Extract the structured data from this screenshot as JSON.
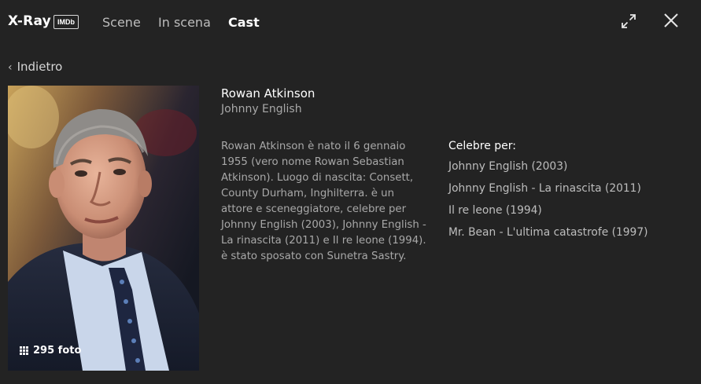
{
  "header": {
    "brand": "X-Ray",
    "imdb_badge": "IMDb",
    "tabs": [
      {
        "label": "Scene",
        "active": false
      },
      {
        "label": "In scena",
        "active": false
      },
      {
        "label": "Cast",
        "active": true
      }
    ],
    "icons": [
      "expand-icon",
      "close-icon"
    ]
  },
  "nav": {
    "back_label": "Indietro"
  },
  "person": {
    "name": "Rowan Atkinson",
    "role": "Johnny English",
    "photo_count": "295 foto",
    "bio": "Rowan Atkinson è nato il 6 gennaio 1955 (vero nome Rowan Sebastian Atkinson). Luogo di nascita: Consett, County Durham, Inghilterra. è un attore e sceneggiatore, celebre per Johnny English (2003), Johnny English - La rinascita (2011) e Il re leone (1994). è stato sposato con Sunetra Sastry."
  },
  "known_for": {
    "title": "Celebre per:",
    "items": [
      "Johnny English (2003)",
      "Johnny English - La rinascita (2011)",
      "Il re leone (1994)",
      "Mr. Bean - L'ultima catastrofe (1997)"
    ]
  },
  "colors": {
    "background": "#232323",
    "text_primary": "#ffffff",
    "text_secondary": "#a8a8a8"
  }
}
